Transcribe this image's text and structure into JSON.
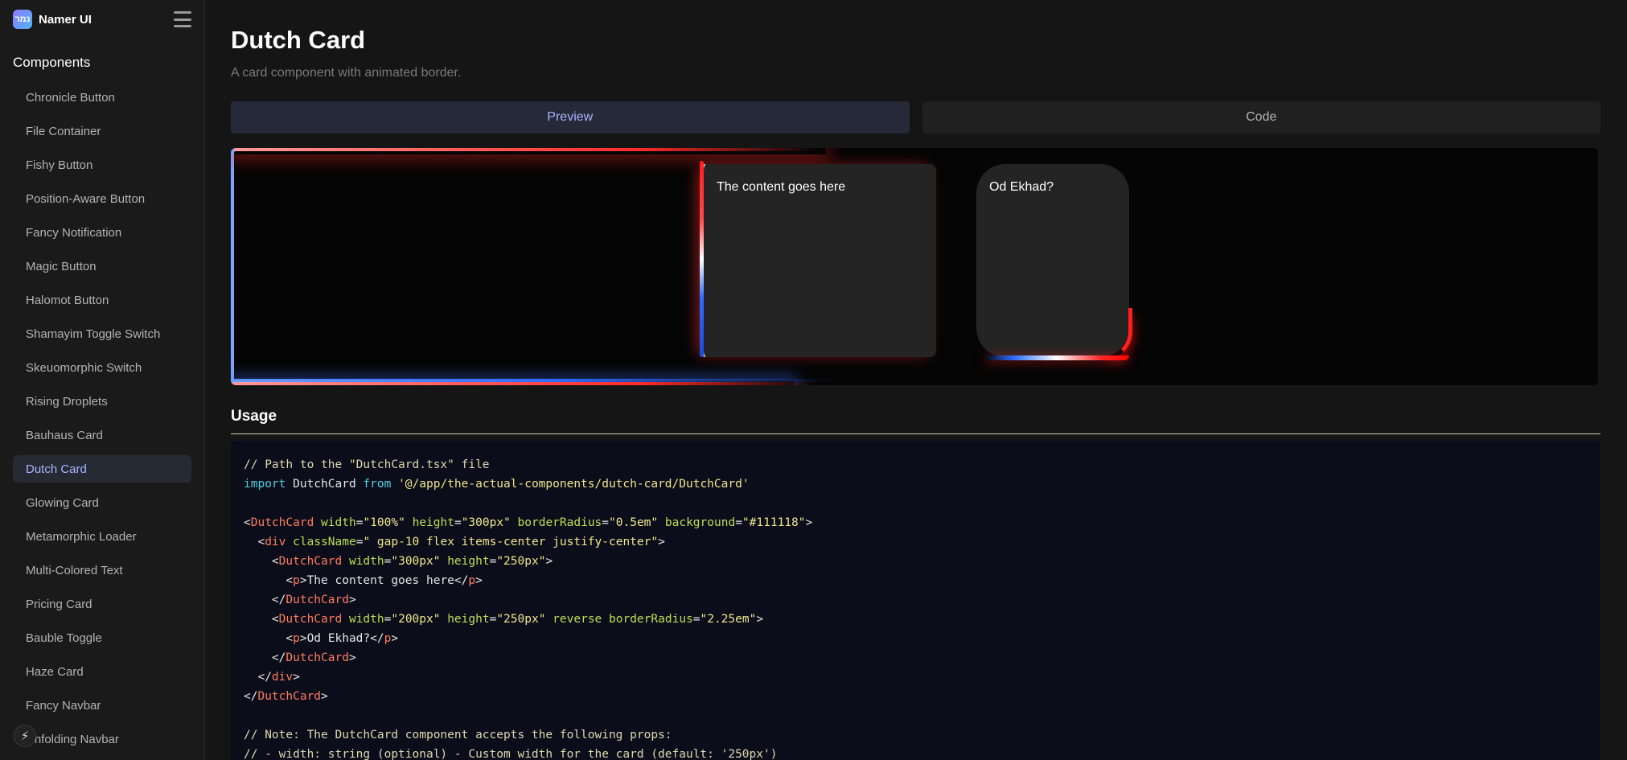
{
  "brand": {
    "name": "Namer UI",
    "logo_text": "נמר"
  },
  "sidebar": {
    "section_title": "Components",
    "items": [
      {
        "label": "Chronicle Button",
        "active": false
      },
      {
        "label": "File Container",
        "active": false
      },
      {
        "label": "Fishy Button",
        "active": false
      },
      {
        "label": "Position-Aware Button",
        "active": false
      },
      {
        "label": "Fancy Notification",
        "active": false
      },
      {
        "label": "Magic Button",
        "active": false
      },
      {
        "label": "Halomot Button",
        "active": false
      },
      {
        "label": "Shamayim Toggle Switch",
        "active": false
      },
      {
        "label": "Skeuomorphic Switch",
        "active": false
      },
      {
        "label": "Rising Droplets",
        "active": false
      },
      {
        "label": "Bauhaus Card",
        "active": false
      },
      {
        "label": "Dutch Card",
        "active": true
      },
      {
        "label": "Glowing Card",
        "active": false
      },
      {
        "label": "Metamorphic Loader",
        "active": false
      },
      {
        "label": "Multi-Colored Text",
        "active": false
      },
      {
        "label": "Pricing Card",
        "active": false
      },
      {
        "label": "Bauble Toggle",
        "active": false
      },
      {
        "label": "Haze Card",
        "active": false
      },
      {
        "label": "Fancy Navbar",
        "active": false
      },
      {
        "label": "Unfolding Navbar",
        "active": false
      }
    ],
    "bolt_icon": "⚡"
  },
  "page": {
    "title": "Dutch Card",
    "subtitle": "A card component with animated border."
  },
  "tabs": [
    {
      "label": "Preview",
      "active": true
    },
    {
      "label": "Code",
      "active": false
    }
  ],
  "preview": {
    "card1_text": "The content goes here",
    "card2_text": "Od Ekhad?"
  },
  "usage": {
    "title": "Usage"
  },
  "colors": {
    "accent": "#a8b4ff",
    "red": "#ff1e1e",
    "blue": "#2c6cff"
  }
}
